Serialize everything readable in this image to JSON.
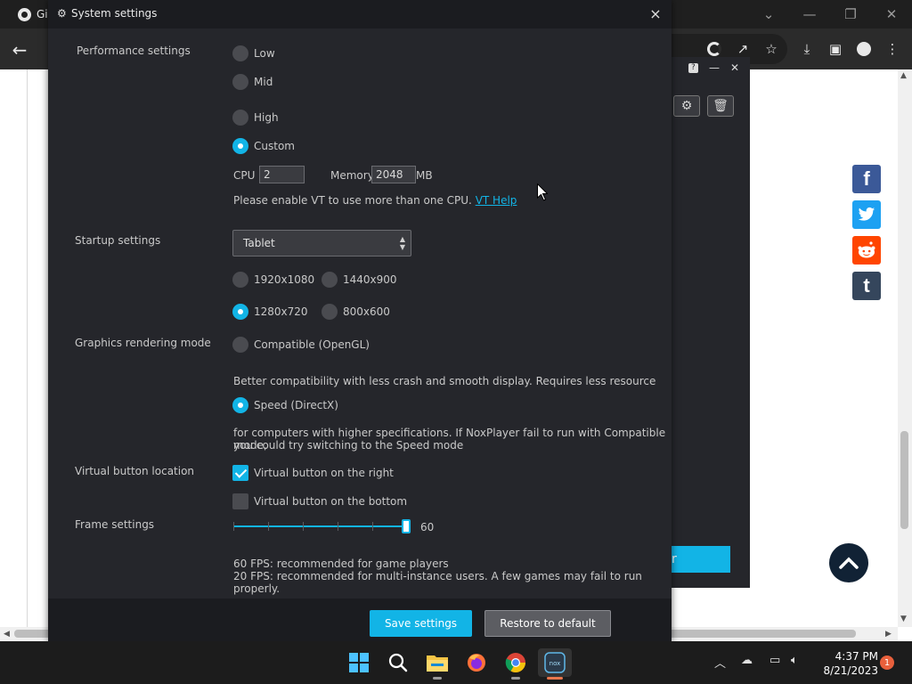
{
  "browser": {
    "tab_title": "Gi",
    "win_controls": [
      "⌄",
      "—",
      "❐",
      "✕"
    ]
  },
  "nox_bg": {
    "help": "?",
    "minimize": "—",
    "close": "✕",
    "cyan_text": "r"
  },
  "dialog": {
    "title": "System settings",
    "close": "×",
    "performance": {
      "label": "Performance settings",
      "options": [
        "Low",
        "Mid",
        "High",
        "Custom"
      ],
      "selected": "Custom",
      "cpu_label": "CPU",
      "cpu_value": "2",
      "memory_label": "Memory",
      "memory_value": "2048",
      "memory_unit": "MB",
      "vt_notice": "Please enable VT to use more than one CPU.",
      "vt_link": "VT Help"
    },
    "startup": {
      "label": "Startup settings",
      "mode": "Tablet",
      "resolutions": [
        "1920x1080",
        "1440x900",
        "1280x720",
        "800x600"
      ],
      "selected": "1280x720"
    },
    "graphics": {
      "label": "Graphics rendering mode",
      "compatible": "Compatible (OpenGL)",
      "compatible_desc": "Better compatibility with less crash and smooth display. Requires less resource",
      "speed": "Speed (DirectX)",
      "speed_desc_1": "for computers with higher specifications. If NoxPlayer fail to run with Compatible mode,",
      "speed_desc_2": "you could try switching to the Speed mode",
      "selected": "Speed (DirectX)"
    },
    "virtual_button": {
      "label": "Virtual button location",
      "right": "Virtual button on the right",
      "bottom": "Virtual button on the bottom",
      "right_checked": true,
      "bottom_checked": false
    },
    "frame": {
      "label": "Frame settings",
      "value": "60",
      "note_1": "60 FPS: recommended for game players",
      "note_2": "20 FPS: recommended for multi-instance users. A few games may fail to run properly."
    },
    "save_label": "Save settings",
    "restore_label": "Restore to default"
  },
  "taskbar": {
    "time": "4:37 PM",
    "date": "8/21/2023",
    "notifications": "1"
  },
  "colors": {
    "accent": "#12b4e6",
    "dialog_bg": "#25262b",
    "facebook": "#3b5998",
    "twitter": "#1da1f2",
    "reddit": "#ff4500",
    "tumblr": "#35465c"
  }
}
